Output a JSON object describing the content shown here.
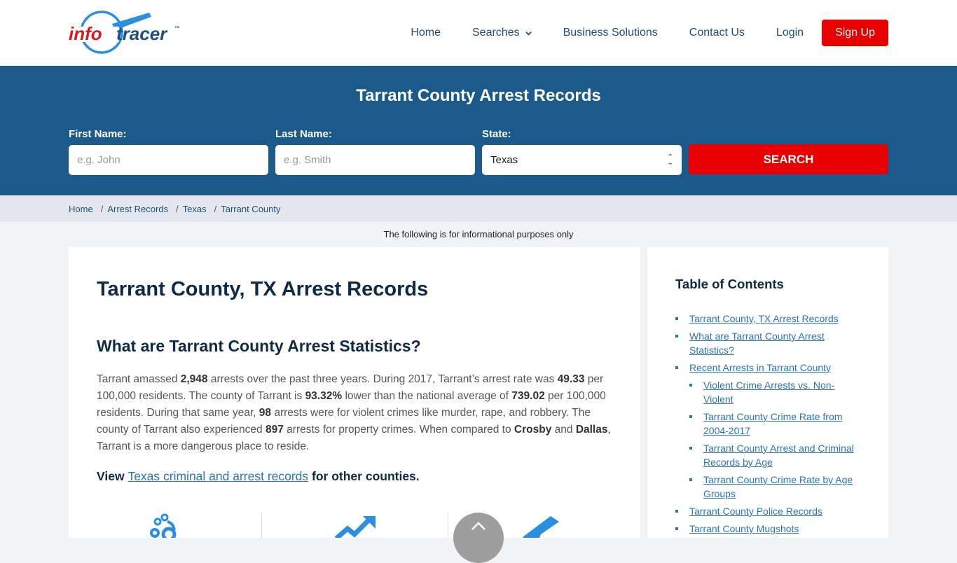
{
  "brand": {
    "logo_left": "info",
    "logo_right": "tracer",
    "trademark": "™",
    "colors": {
      "red": "#e80000",
      "blue": "#1c5a8c",
      "navy": "#0e2a47",
      "link": "#2a73c0"
    }
  },
  "nav": {
    "items": [
      {
        "label": "Home"
      },
      {
        "label": "Searches",
        "icon": "chevron-down-icon"
      },
      {
        "label": "Business Solutions"
      },
      {
        "label": "Contact Us"
      },
      {
        "label": "Login"
      }
    ],
    "signup_label": "Sign Up"
  },
  "hero": {
    "title": "Tarrant County Arrest Records",
    "first_name": {
      "label": "First Name:",
      "placeholder": "e.g. John",
      "value": ""
    },
    "last_name": {
      "label": "Last Name:",
      "placeholder": "e.g. Smith",
      "value": ""
    },
    "state": {
      "label": "State:",
      "value": "Texas"
    },
    "search_label": "SEARCH"
  },
  "breadcrumb": [
    {
      "label": "Home"
    },
    {
      "label": "Arrest Records"
    },
    {
      "label": "Texas"
    },
    {
      "label": "Tarrant County"
    }
  ],
  "notice": "The following is for informational purposes only",
  "main": {
    "title": "Tarrant County, TX Arrest Records",
    "section_title": "What are Tarrant County Arrest Statistics?",
    "paragraph": {
      "t1": "Tarrant amassed ",
      "b1": "2,948",
      "t2": " arrests over the past three years. During 2017, Tarrant’s arrest rate was ",
      "b2": "49.33",
      "t3": " per 100,000 residents. The county of Tarrant is ",
      "b3": "93.32%",
      "t4": " lower than the national average of ",
      "b4": "739.02",
      "t5": " per 100,000 residents. During that same year, ",
      "b5": "98",
      "t6": " arrests were for violent crimes like murder, rape, and robbery. The county of Tarrant also experienced ",
      "b6": "897",
      "t7": " arrests for property crimes. When compared to ",
      "b7": "Crosby",
      "t8": " and ",
      "b8": "Dallas",
      "t9": ", Tarrant is a more dangerous place to reside."
    },
    "view_prefix": "View ",
    "view_link": "Texas criminal and arrest records",
    "view_suffix": " for other counties.",
    "stat_icons": [
      "handcuffs-icon",
      "trend-up-icon",
      "gun-icon"
    ]
  },
  "toc": {
    "title": "Table of Contents",
    "items": [
      {
        "label": "Tarrant County, TX Arrest Records",
        "level": 1
      },
      {
        "label": "What are Tarrant County Arrest Statistics?",
        "level": 1
      },
      {
        "label": "Recent Arrests in Tarrant County",
        "level": 1
      },
      {
        "label": "Violent Crime Arrests vs. Non-Violent",
        "level": 2
      },
      {
        "label": "Tarrant County Crime Rate from 2004-2017",
        "level": 2
      },
      {
        "label": "Tarrant County Arrest and Criminal Records by Age",
        "level": 2
      },
      {
        "label": "Tarrant County Crime Rate by Age Groups",
        "level": 2
      },
      {
        "label": "Tarrant County Police Records",
        "level": 1
      },
      {
        "label": "Tarrant County Mugshots",
        "level": 1
      }
    ]
  }
}
